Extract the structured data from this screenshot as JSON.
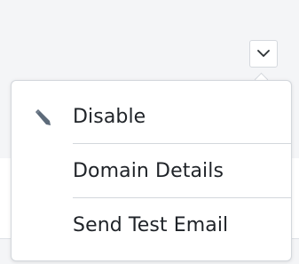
{
  "dropdown": {
    "toggle_icon": "chevron-down-icon",
    "items": [
      {
        "label": "Disable",
        "icon": "pencil-icon"
      },
      {
        "label": "Domain Details"
      },
      {
        "label": "Send Test Email"
      }
    ]
  },
  "colors": {
    "background": "#f4f5f7",
    "menu_background": "#ffffff",
    "text": "#1f2328",
    "border": "#d3d7dc",
    "icon": "#5d6b7a"
  }
}
